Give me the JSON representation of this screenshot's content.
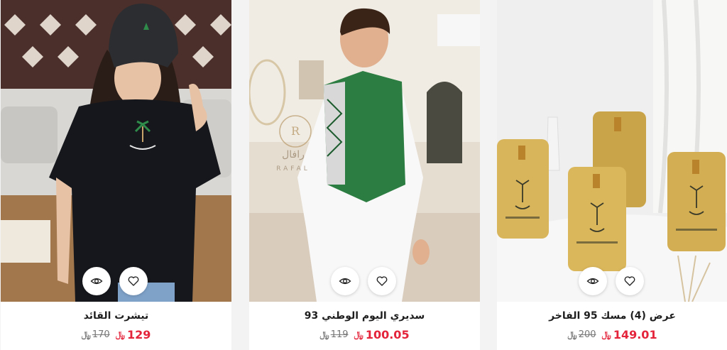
{
  "colors": {
    "accent_price": "#e4243b",
    "saudi_green": "#1f7a3a",
    "card_bg": "#ffffff"
  },
  "currency_symbol": "﷼",
  "products": [
    {
      "title": "تيشرت القائد",
      "price_old": "170",
      "price_new": "129",
      "image_desc": "woman in black t-shirt and cap with palm and swords emblem",
      "icons": [
        "eye-icon",
        "heart-icon"
      ]
    },
    {
      "title": "سديري اليوم الوطني 93",
      "price_old": "119",
      "price_new": "100.05",
      "watermark_text": "رافال",
      "watermark_sub": "RAFAL",
      "image_desc": "boy in white thobe with green patterned sadeeri vest",
      "icons": [
        "eye-icon",
        "heart-icon"
      ]
    },
    {
      "title": "عرض (4) مسك 95 الفاخر",
      "price_old": "200",
      "price_new": "149.01",
      "image_desc": "four gold perfume plaques with palm emblem",
      "icons": [
        "eye-icon",
        "heart-icon"
      ]
    }
  ]
}
